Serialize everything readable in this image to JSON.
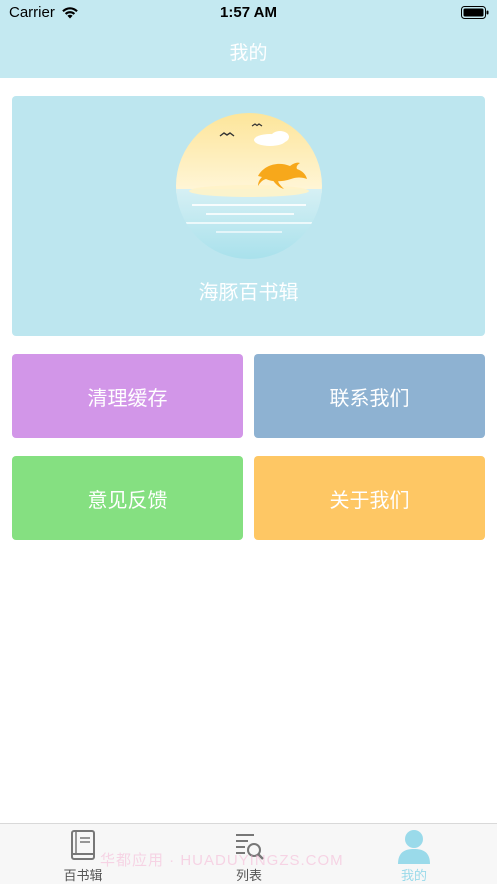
{
  "status_bar": {
    "carrier": "Carrier",
    "time": "1:57 AM"
  },
  "nav": {
    "title": "我的"
  },
  "hero": {
    "app_name": "海豚百书辑"
  },
  "actions": {
    "clear_cache": "清理缓存",
    "contact_us": "联系我们",
    "feedback": "意见反馈",
    "about_us": "关于我们"
  },
  "tab_bar": {
    "tabs": [
      {
        "label": "百书辑",
        "icon": "book-icon"
      },
      {
        "label": "列表",
        "icon": "list-search-icon"
      },
      {
        "label": "我的",
        "icon": "person-icon"
      }
    ],
    "active_index": 2
  },
  "watermark": "华都应用 · HUADUYINGZS.COM",
  "colors": {
    "header": "#c4e9f1",
    "hero_bg": "#bde6ef",
    "clear_cache": "#d296e8",
    "contact_us": "#8eb2d2",
    "feedback": "#85e081",
    "about_us": "#fec764",
    "tab_active": "#9adaea"
  }
}
